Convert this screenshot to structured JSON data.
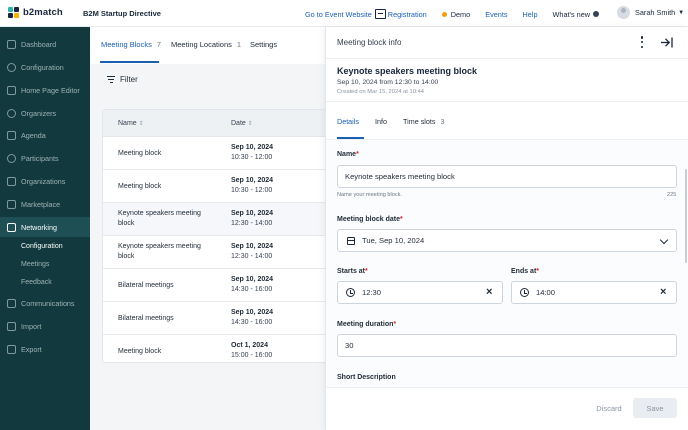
{
  "header": {
    "logo_text": "b2match",
    "event_name": "B2M Startup Directive",
    "nav": {
      "go_to_event": "Go to Event Website",
      "registration": "Registration",
      "demo": "Demo",
      "events": "Events",
      "help": "Help",
      "whats_new": "What's new"
    },
    "user_name": "Sarah Smith"
  },
  "sidebar": {
    "items": [
      {
        "label": "Dashboard",
        "icon": "dashboard-icon"
      },
      {
        "label": "Configuration",
        "icon": "gear-icon"
      },
      {
        "label": "Home Page Editor",
        "icon": "editor-icon"
      },
      {
        "label": "Organizers",
        "icon": "organizers-icon"
      },
      {
        "label": "Agenda",
        "icon": "agenda-icon"
      },
      {
        "label": "Participants",
        "icon": "participants-icon"
      },
      {
        "label": "Organizations",
        "icon": "organizations-icon"
      },
      {
        "label": "Marketplace",
        "icon": "marketplace-icon"
      },
      {
        "label": "Networking",
        "icon": "networking-icon"
      },
      {
        "label": "Communications",
        "icon": "communications-icon"
      },
      {
        "label": "Import",
        "icon": "import-icon"
      },
      {
        "label": "Export",
        "icon": "export-icon"
      }
    ],
    "networking_sub": [
      "Configuration",
      "Meetings",
      "Feedback"
    ]
  },
  "main": {
    "tabs": [
      {
        "label": "Meeting Blocks",
        "count": "7"
      },
      {
        "label": "Meeting Locations",
        "count": "1"
      },
      {
        "label": "Settings",
        "count": ""
      }
    ],
    "filter_label": "Filter",
    "table": {
      "columns": [
        "Name",
        "Date"
      ],
      "rows": [
        {
          "name": "Meeting block",
          "date": "Sep 10, 2024",
          "time": "10:30 - 12:00"
        },
        {
          "name": "Meeting block",
          "date": "Sep 10, 2024",
          "time": "10:30 - 12:00"
        },
        {
          "name": "Keynote speakers meeting block",
          "date": "Sep 10, 2024",
          "time": "12:30 - 14:00"
        },
        {
          "name": "Keynote speakers meeting block",
          "date": "Sep 10, 2024",
          "time": "12:30 - 14:00"
        },
        {
          "name": "Bilateral meetings",
          "date": "Sep 10, 2024",
          "time": "14:30 - 16:00"
        },
        {
          "name": "Bilateral meetings",
          "date": "Sep 10, 2024",
          "time": "14:30 - 16:00"
        },
        {
          "name": "Meeting block",
          "date": "Oct 1, 2024",
          "time": "15:00 - 16:00"
        }
      ]
    }
  },
  "panel": {
    "header_title": "Meeting block info",
    "title": "Keynote speakers meeting block",
    "subtitle": "Sep 10, 2024 from 12:30 to 14:00",
    "created": "Created on Mar 15, 2024 at 10:44",
    "tabs": [
      {
        "label": "Details",
        "count": ""
      },
      {
        "label": "Info",
        "count": ""
      },
      {
        "label": "Time slots",
        "count": "3"
      }
    ],
    "form": {
      "name_label": "Name",
      "name_value": "Keynote speakers meeting block",
      "name_hint": "Name your meeting block.",
      "name_counter": "225",
      "date_label": "Meeting block date",
      "date_value": "Tue, Sep 10, 2024",
      "starts_label": "Starts at",
      "starts_value": "12:30",
      "ends_label": "Ends at",
      "ends_value": "14:00",
      "duration_label": "Meeting duration",
      "duration_value": "30",
      "short_desc_label": "Short Description",
      "required_mark": "*"
    },
    "discard_label": "Discard",
    "save_label": "Save"
  },
  "colors": {
    "sidebar_bg": "#12393d",
    "accent": "#1a5fb4",
    "required": "#dc2626"
  }
}
